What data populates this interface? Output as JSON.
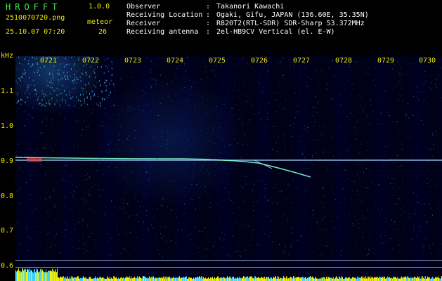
{
  "app": {
    "title": "HROFFT",
    "version": "1.0.0"
  },
  "file": {
    "name": "2510070720.png",
    "datetime": "25.10.07 07:20"
  },
  "meteor": {
    "label": "meteor",
    "count": "26"
  },
  "info": [
    {
      "label": "Observer",
      "value": "Takanori Kawachi"
    },
    {
      "label": "Receiving Location",
      "value": "Ogaki, Gifu, JAPAN (136.60E, 35.35N)"
    },
    {
      "label": "Receiver",
      "value": "R820T2(RTL-SDR) SDR-Sharp 53.372MHz"
    },
    {
      "label": "Receiving antenna",
      "value": "2el-HB9CV Vertical (el. E-W)"
    }
  ],
  "info_separator": ":",
  "axis": {
    "unit": "kHz",
    "y_ticks": [
      "1.1",
      "1.0",
      "0.9",
      "0.8",
      "0.7",
      "0.6"
    ],
    "x_ticks": [
      "0721",
      "0722",
      "0723",
      "0724",
      "0725",
      "0726",
      "0727",
      "0728",
      "0729",
      "0730"
    ]
  },
  "colors": {
    "title": "#3ef03e",
    "labels": "#e8e800",
    "text": "#ffffff",
    "carrier": "#9fd8ff",
    "meteor_trail": "#7fffd0",
    "amplitude": "#f0f000"
  }
}
